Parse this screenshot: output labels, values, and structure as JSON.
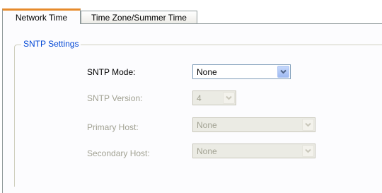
{
  "tabs": [
    {
      "label": "Network Time",
      "active": true
    },
    {
      "label": "Time Zone/Summer Time",
      "active": false
    }
  ],
  "group": {
    "title": "SNTP Settings"
  },
  "fields": {
    "mode": {
      "label": "SNTP Mode:",
      "value": "None",
      "enabled": true
    },
    "version": {
      "label": "SNTP Version:",
      "value": "4",
      "enabled": false
    },
    "primary": {
      "label": "Primary Host:",
      "value": "None",
      "enabled": false
    },
    "secondary": {
      "label": "Secondary Host:",
      "value": "None",
      "enabled": false
    }
  },
  "colors": {
    "active_tab_accent": "#e68b2c",
    "group_title": "#0046d5",
    "disabled_text": "#a1a192"
  },
  "icons": {
    "dropdown": "chevron-down-icon"
  }
}
